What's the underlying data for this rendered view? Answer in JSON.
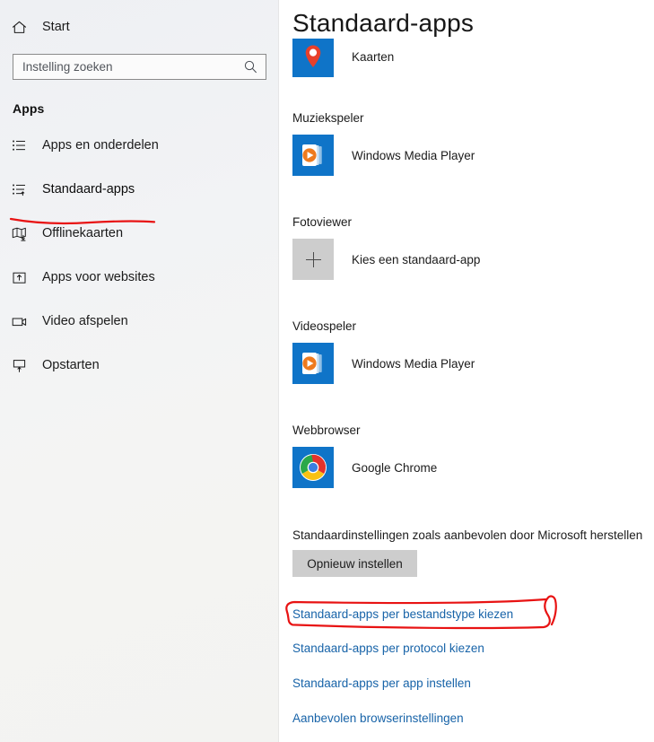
{
  "sidebar": {
    "home": {
      "label": "Start",
      "icon": "home-icon"
    },
    "search": {
      "placeholder": "Instelling zoeken",
      "value": "",
      "icon": "search-icon"
    },
    "section_heading": "Apps",
    "items": [
      {
        "label": "Apps en onderdelen",
        "icon": "list-icon",
        "selected": false
      },
      {
        "label": "Standaard-apps",
        "icon": "list-arrow-icon",
        "selected": true
      },
      {
        "label": "Offlinekaarten",
        "icon": "map-download-icon",
        "selected": false
      },
      {
        "label": "Apps voor websites",
        "icon": "box-arrow-up-icon",
        "selected": false
      },
      {
        "label": "Video afspelen",
        "icon": "video-camera-icon",
        "selected": false
      },
      {
        "label": "Opstarten",
        "icon": "monitor-arrow-up-icon",
        "selected": false
      }
    ]
  },
  "main": {
    "title": "Standaard-apps",
    "groups": [
      {
        "label": "",
        "app": "Kaarten",
        "icon": "maps-tile"
      },
      {
        "label": "Muziekspeler",
        "app": "Windows Media Player",
        "icon": "wmp-tile"
      },
      {
        "label": "Fotoviewer",
        "app": "Kies een standaard-app",
        "icon": "plus-tile"
      },
      {
        "label": "Videospeler",
        "app": "Windows Media Player",
        "icon": "wmp-tile"
      },
      {
        "label": "Webbrowser",
        "app": "Google Chrome",
        "icon": "chrome-tile"
      }
    ],
    "reset_text": "Standaardinstellingen zoals aanbevolen door Microsoft herstellen",
    "reset_button": "Opnieuw instellen",
    "links": [
      "Standaard-apps per bestandstype kiezen",
      "Standaard-apps per protocol kiezen",
      "Standaard-apps per app instellen",
      "Aanbevolen browserinstellingen"
    ]
  },
  "annotations": {
    "color": "#e81313",
    "sidebar_underline": "Standaard-apps",
    "link_circle": "Standaard-apps per bestandstype kiezen"
  }
}
